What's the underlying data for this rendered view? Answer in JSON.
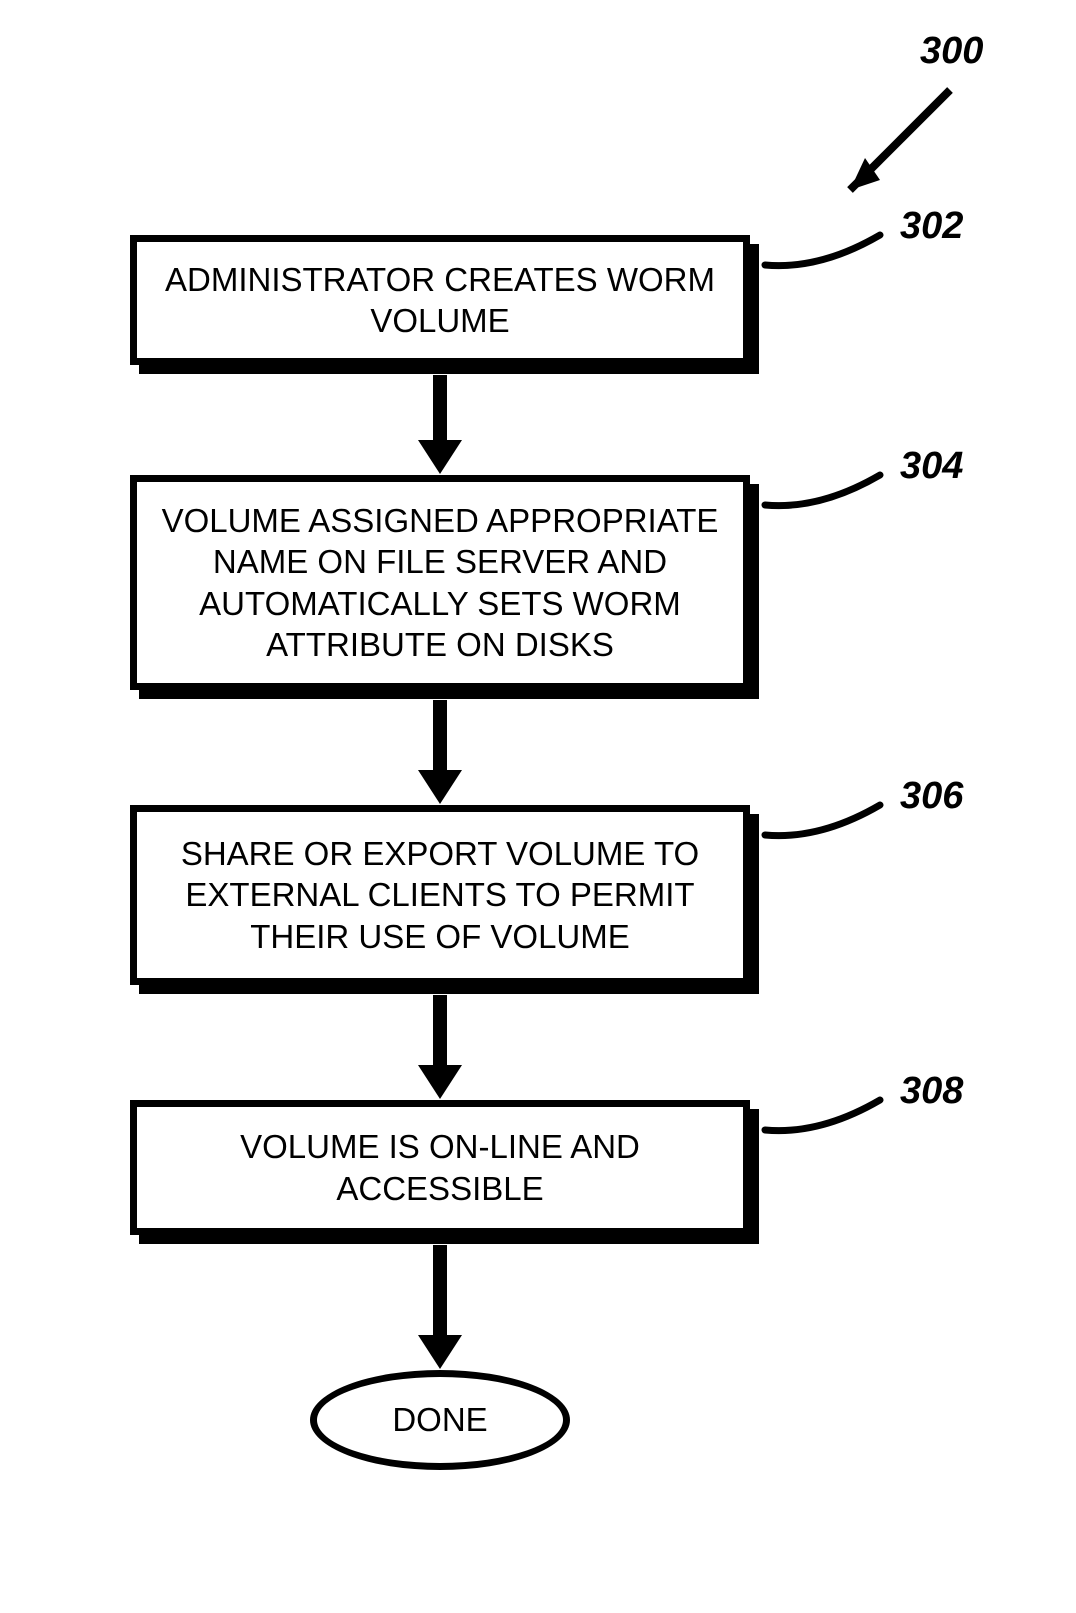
{
  "diagram": {
    "figure_ref": "300",
    "steps": [
      {
        "ref": "302",
        "text": "ADMINISTRATOR CREATES WORM VOLUME"
      },
      {
        "ref": "304",
        "text": "VOLUME ASSIGNED APPROPRIATE NAME ON FILE SERVER AND AUTOMATICALLY SETS WORM ATTRIBUTE ON DISKS"
      },
      {
        "ref": "306",
        "text": "SHARE OR EXPORT VOLUME TO EXTERNAL CLIENTS TO PERMIT THEIR USE OF VOLUME"
      },
      {
        "ref": "308",
        "text": "VOLUME IS ON-LINE AND ACCESSIBLE"
      }
    ],
    "terminator": "DONE"
  }
}
